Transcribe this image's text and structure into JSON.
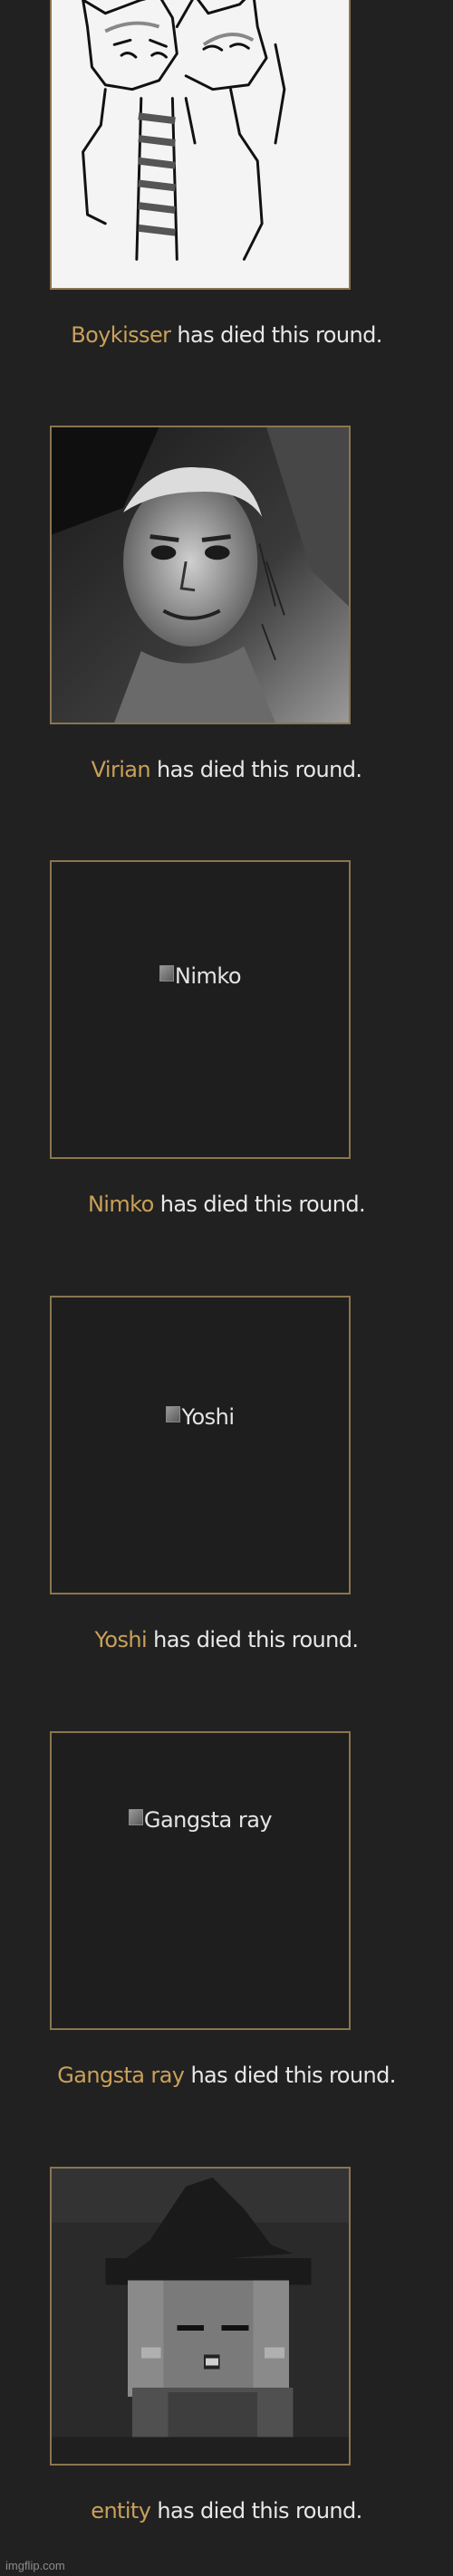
{
  "colors": {
    "background": "#212121",
    "frame": "#8a7550",
    "name": "#c9a05a",
    "text": "#e8e8e8"
  },
  "entries": [
    {
      "name": "Boykisser",
      "suffix": " has died this round.",
      "image": "drawn-cat-characters",
      "alt": ""
    },
    {
      "name": "Virian",
      "suffix": " has died this round.",
      "image": "selfie-photo",
      "alt": ""
    },
    {
      "name": "Nimko",
      "suffix": " has died this round.",
      "image": "broken-image",
      "alt": "Nimko"
    },
    {
      "name": "Yoshi",
      "suffix": " has died this round.",
      "image": "broken-image",
      "alt": "Yoshi"
    },
    {
      "name": "Gangsta ray",
      "suffix": " has died this round.",
      "image": "broken-image",
      "alt": "Gangsta ray"
    },
    {
      "name": "entity",
      "suffix": " has died this round.",
      "image": "pixel-witch-character",
      "alt": ""
    }
  ],
  "watermark": "imgflip.com"
}
